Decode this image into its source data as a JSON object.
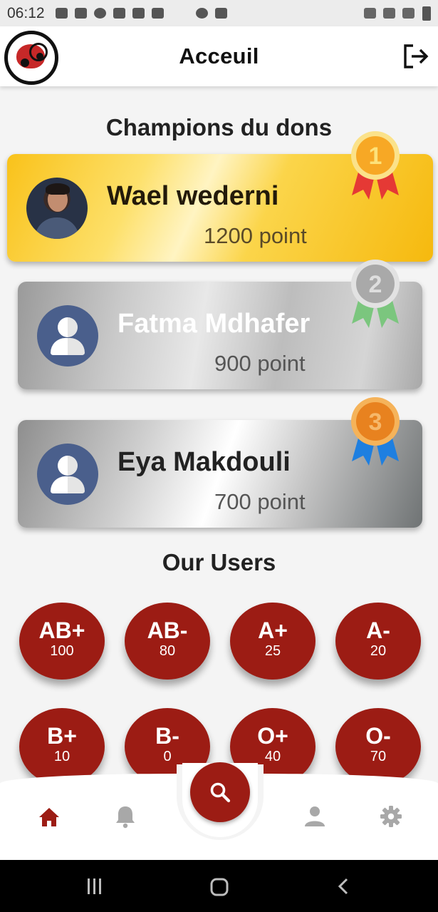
{
  "status_bar": {
    "time": "06:12"
  },
  "app_bar": {
    "title": "Acceuil"
  },
  "champions": {
    "title": "Champions du dons",
    "items": [
      {
        "rank": "1",
        "name": "Wael wederni",
        "points": "1200 point"
      },
      {
        "rank": "2",
        "name": "Fatma Mdhafer",
        "points": "900 point"
      },
      {
        "rank": "3",
        "name": "Eya Makdouli",
        "points": "700 point"
      }
    ]
  },
  "users": {
    "title": "Our Users",
    "groups": [
      {
        "type": "AB+",
        "count": "100"
      },
      {
        "type": "AB-",
        "count": "80"
      },
      {
        "type": "A+",
        "count": "25"
      },
      {
        "type": "A-",
        "count": "20"
      },
      {
        "type": "B+",
        "count": "10"
      },
      {
        "type": "B-",
        "count": "0"
      },
      {
        "type": "O+",
        "count": "40"
      },
      {
        "type": "O-",
        "count": "70"
      }
    ]
  },
  "colors": {
    "accent": "#9c1c14",
    "gold": "#f9c21a",
    "silver": "#c9c9c9",
    "nav_active": "#9c1c14",
    "nav_inactive": "#a8a8a8"
  },
  "bottom_nav": {
    "items": [
      {
        "icon": "home-icon",
        "active": true
      },
      {
        "icon": "bell-icon",
        "active": false
      },
      {
        "icon": "search-icon",
        "active": false
      },
      {
        "icon": "person-icon",
        "active": false
      },
      {
        "icon": "gear-icon",
        "active": false
      }
    ]
  }
}
